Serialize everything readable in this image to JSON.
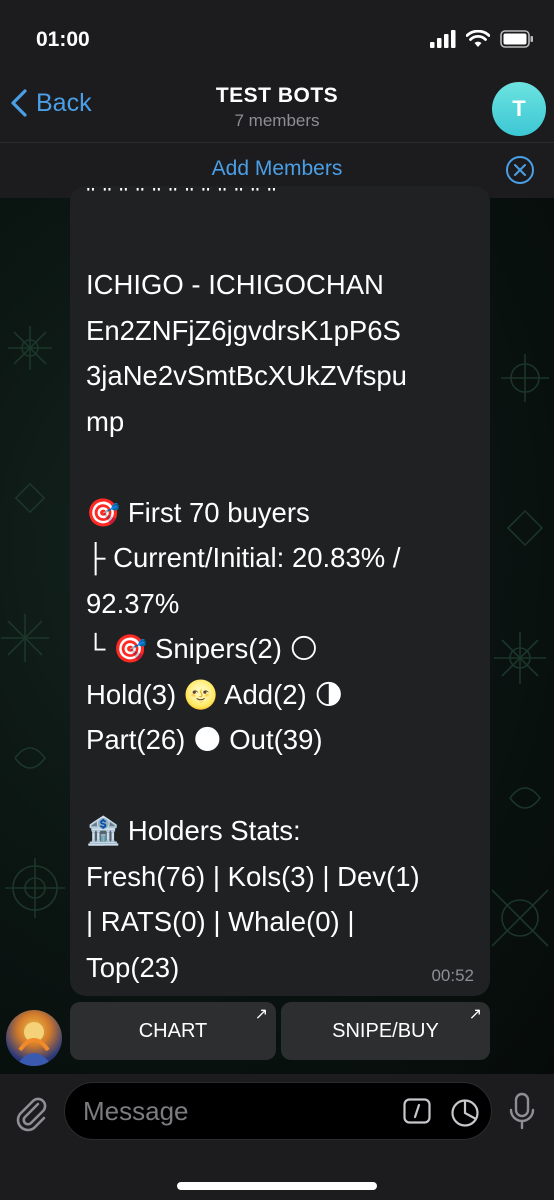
{
  "status_bar": {
    "time": "01:00"
  },
  "header": {
    "back_label": "Back",
    "title": "TEST BOTS",
    "subtitle": "7 members",
    "avatar_letter": "T"
  },
  "banner": {
    "add_members_label": "Add Members"
  },
  "message": {
    "top_line": "\" \" \" \" \" \" \" \" \" \" \" \"",
    "lines": [
      "ICHIGO - ICHIGOCHAN",
      "En2ZNFjZ6jgvdrsK1pP6S",
      "3jaNe2vSmtBcXUkZVfspu",
      "mp",
      "",
      "🎯 First 70 buyers",
      " ├ Current/Initial: 20.83% /",
      "92.37%",
      " └ 🎯 Snipers(2) 🌕",
      "Hold(3) 🌝 Add(2) 🌗",
      "Part(26) 🌑 Out(39)",
      "",
      "🏦 Holders Stats:",
      "Fresh(76) | Kols(3) | Dev(1)",
      "| RATS(0) | Whale(0) |",
      "Top(23)"
    ],
    "time": "00:52"
  },
  "inline_buttons": [
    {
      "label": "CHART",
      "arrow": "↗"
    },
    {
      "label": "SNIPE/BUY",
      "arrow": "↗"
    }
  ],
  "input": {
    "placeholder": "Message"
  },
  "colors": {
    "accent": "#4a9fe6",
    "bubble": "#1f2123",
    "bar": "#1c1c1e",
    "avatar": "#4fd2dc"
  }
}
